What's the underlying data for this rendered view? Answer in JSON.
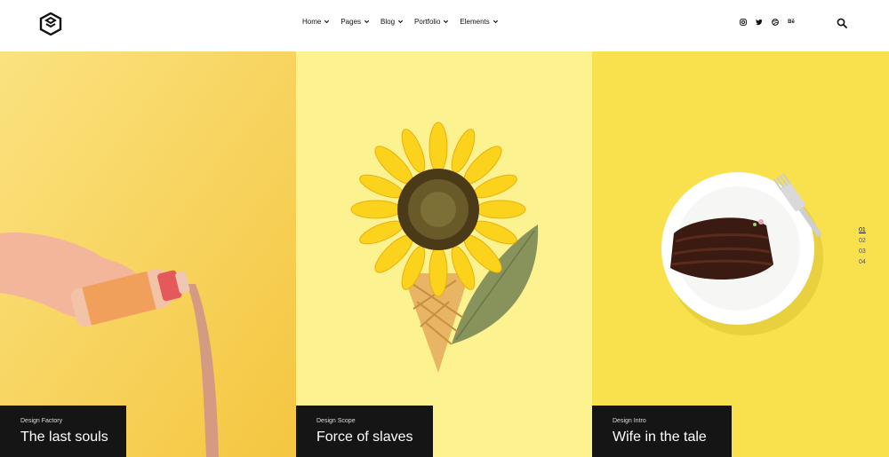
{
  "nav": {
    "items": [
      {
        "label": "Home"
      },
      {
        "label": "Pages"
      },
      {
        "label": "Blog"
      },
      {
        "label": "Portfolio"
      },
      {
        "label": "Elements"
      }
    ]
  },
  "social": [
    {
      "icon": "instagram-icon",
      "glyph": "◎"
    },
    {
      "icon": "twitter-icon",
      "glyph": "✔"
    },
    {
      "icon": "dribbble-icon",
      "glyph": "⊛"
    },
    {
      "icon": "behance-icon",
      "glyph": "Bē"
    }
  ],
  "panels": [
    {
      "subtitle": "Design Factory",
      "title": "The last souls",
      "bg": "#f9d96a"
    },
    {
      "subtitle": "Design Scope",
      "title": "Force of slaves",
      "bg": "#fcf28f"
    },
    {
      "subtitle": "Design Intro",
      "title": "Wife in the tale",
      "bg": "#f8e14d"
    }
  ],
  "pager": [
    "01",
    "02",
    "03",
    "04"
  ],
  "colors": {
    "caption_bg": "#151515",
    "accent_text": "#111111"
  }
}
